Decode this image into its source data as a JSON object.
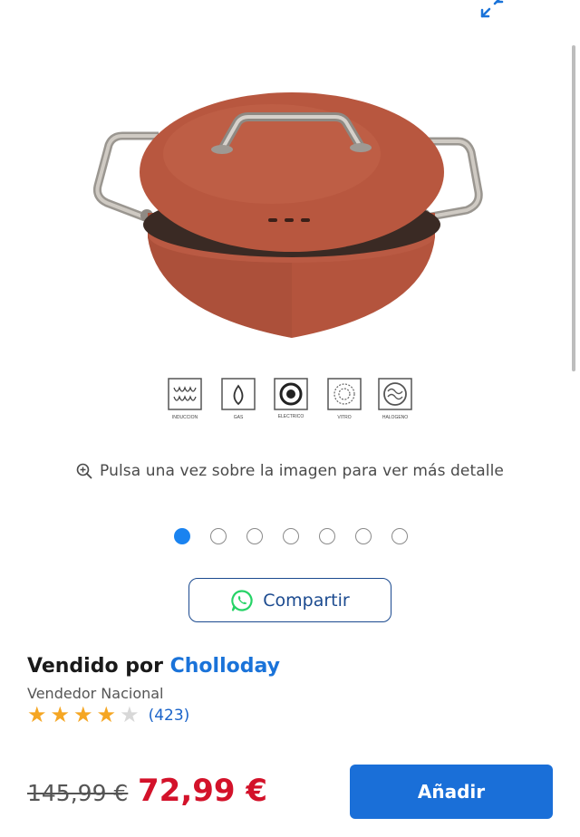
{
  "gallery": {
    "hint_text": "Pulsa una vez sobre la imagen para ver más detalle",
    "dots_total": 7,
    "active_index": 1,
    "cooktop_labels": [
      "INDUCCION",
      "GAS",
      "ELECTRICO",
      "VITRO",
      "HALOGENO"
    ]
  },
  "share": {
    "label": "Compartir"
  },
  "seller": {
    "prefix": "Vendido por",
    "name": "Cholloday",
    "type": "Vendedor Nacional",
    "rating_stars": 4,
    "rating_max": 5,
    "rating_count": "(423)"
  },
  "price": {
    "old": "145,99 €",
    "new": "72,99 €"
  },
  "cart": {
    "add_label": "Añadir"
  },
  "colors": {
    "accent_blue": "#1a6fd8",
    "price_red": "#d3122a",
    "star_gold": "#f5a623",
    "pot_terracotta": "#b4543d",
    "whatsapp_green": "#25d366"
  }
}
